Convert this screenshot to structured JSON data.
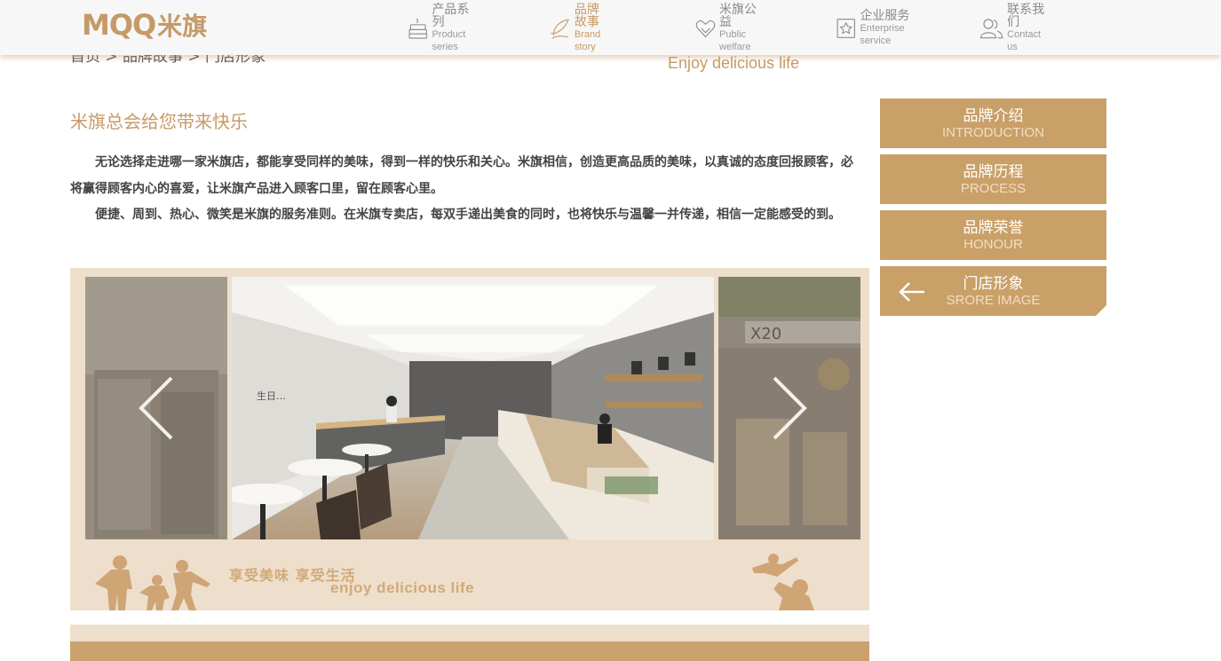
{
  "header": {
    "logo": {
      "latin": "MQQ",
      "cn": "米旗"
    },
    "nav": [
      {
        "cn": "产品系列",
        "en": "Product series",
        "icon": "cake-icon",
        "active": false
      },
      {
        "cn": "品牌故事",
        "en": "Brand story",
        "icon": "quill-icon",
        "active": true
      },
      {
        "cn": "米旗公益",
        "en": "Public welfare",
        "icon": "heart-hands-icon",
        "active": false
      },
      {
        "cn": "企业服务",
        "en": "Enterprise service",
        "icon": "star-badge-icon",
        "active": false
      },
      {
        "cn": "联系我们",
        "en": "Contact us",
        "icon": "users-icon",
        "active": false
      }
    ]
  },
  "breadcrumb": "首页 > 品牌故事 > 门店形象",
  "slogan": "Enjoy delicious life",
  "article": {
    "title": "米旗总会给您带来快乐",
    "paragraphs": [
      "无论选择走进哪一家米旗店，都能享受同样的美味，得到一样的快乐和关心。米旗相信，创造更高品质的美味，以真诚的态度回报顾客，必将赢得顾客内心的喜爱，让米旗产品进入顾客口里，留在顾客心里。",
      "便捷、周到、热心、微笑是米旗的服务准则。在米旗专卖店，每双手递出美食的同时，也将快乐与温馨一并传递，相信一定能感受的到。"
    ]
  },
  "gallery": {
    "enjoy_cn": "享受美味  享受生活",
    "enjoy_en": "enjoy delicious life",
    "storefront_text": "X20",
    "cake_text": "生日…"
  },
  "sidebar": [
    {
      "cn": "品牌介绍",
      "en": "INTRODUCTION",
      "active": false
    },
    {
      "cn": "品牌历程",
      "en": "PROCESS",
      "active": false
    },
    {
      "cn": "品牌荣誉",
      "en": "HONOUR",
      "active": false
    },
    {
      "cn": "门店形象",
      "en": "SRORE IMAGE",
      "active": true
    }
  ],
  "colors": {
    "accent": "#c69a68",
    "sidebar": "#c9a068",
    "gallery_bg": "#eedfcc"
  }
}
